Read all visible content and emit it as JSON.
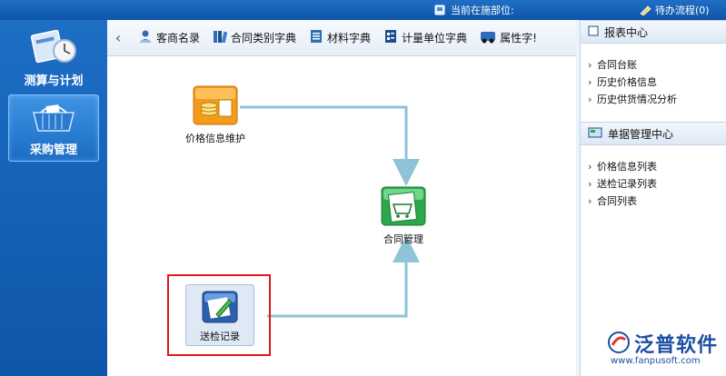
{
  "topbar": {
    "location_label": "当前在施部位:",
    "todo_label": "待办流程(0)"
  },
  "sidebar": {
    "items": [
      {
        "label": "测算与计划",
        "icon": "calculator-clock-icon",
        "active": false
      },
      {
        "label": "采购管理",
        "icon": "shopping-basket-icon",
        "active": true
      }
    ]
  },
  "toolbar": {
    "items": [
      {
        "label": "客商名录",
        "icon": "person-icon"
      },
      {
        "label": "合同类别字典",
        "icon": "books-icon"
      },
      {
        "label": "材料字典",
        "icon": "list-icon"
      },
      {
        "label": "计量单位字典",
        "icon": "unit-list-icon"
      },
      {
        "label": "属性字!",
        "icon": "attribute-icon"
      }
    ]
  },
  "flow": {
    "nodes": {
      "price": "价格信息维护",
      "contract": "合同管理",
      "inspection": "送检记录"
    }
  },
  "right_panel": {
    "report_center": {
      "title": "报表中心",
      "items": [
        "合同台账",
        "历史价格信息",
        "历史供货情况分析"
      ]
    },
    "document_center": {
      "title": "单据管理中心",
      "items": [
        "价格信息列表",
        "送检记录列表",
        "合同列表"
      ]
    }
  },
  "watermark": {
    "brand": "泛普软件",
    "url": "www.fanpusoft.com"
  },
  "colors": {
    "sidebar_blue": "#1565c0",
    "flow_arrow": "#8ec3d8",
    "highlight_red": "#e01818"
  }
}
